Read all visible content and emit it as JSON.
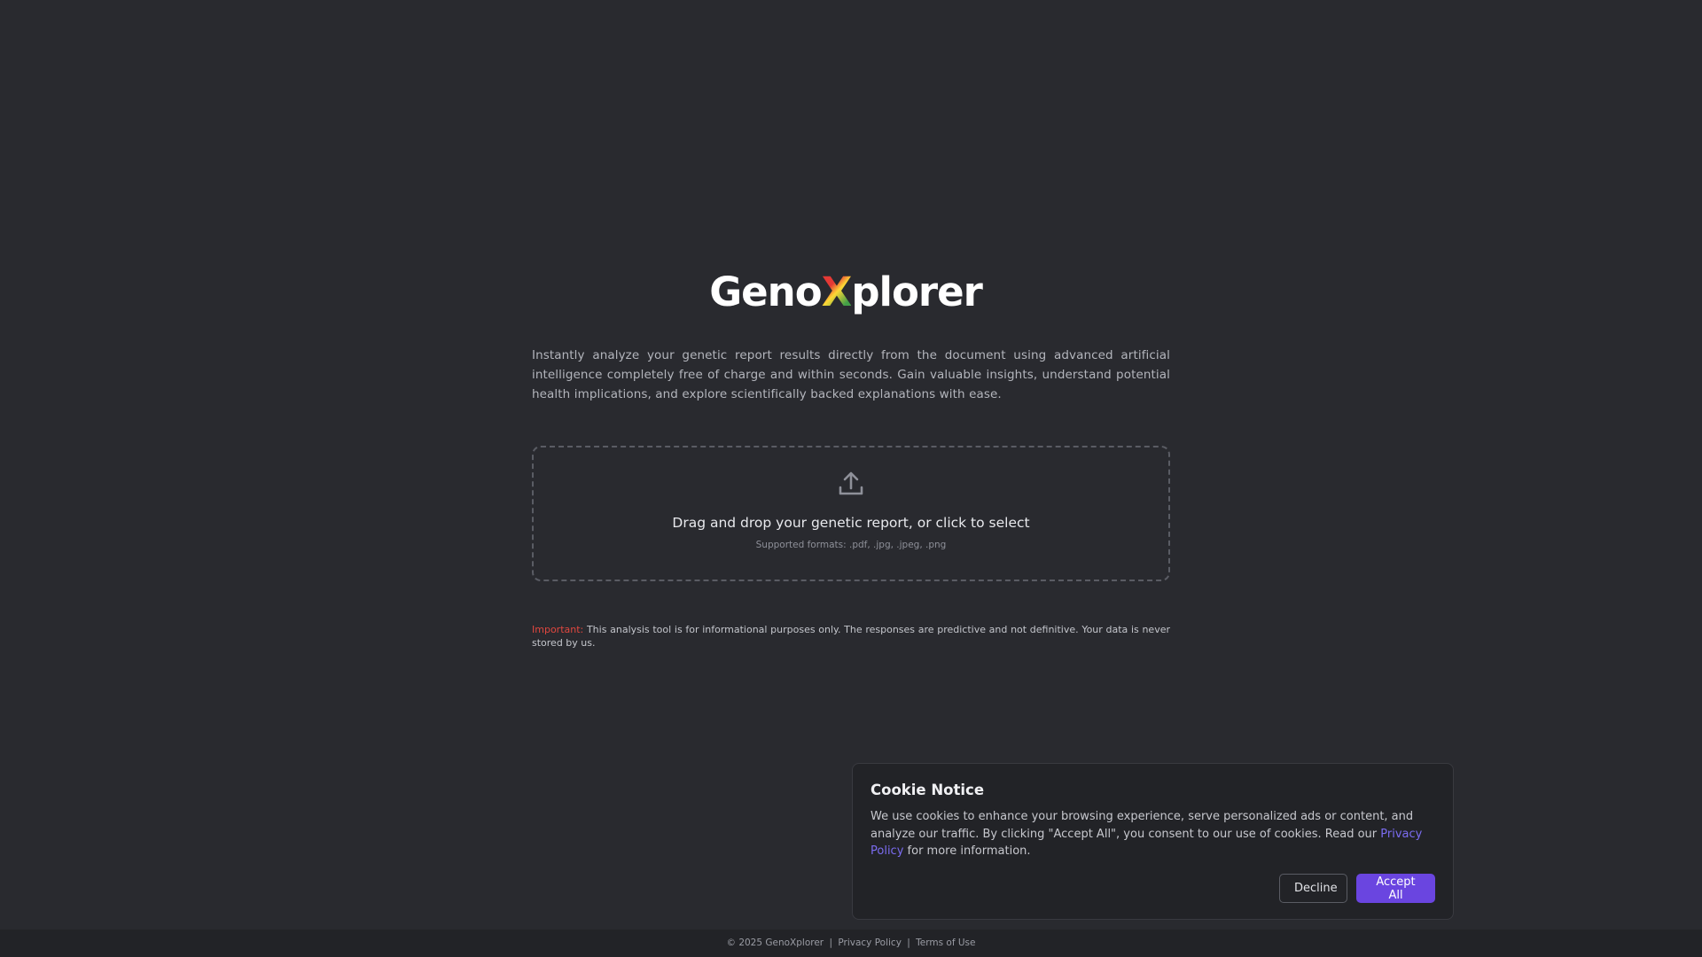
{
  "brand": {
    "logo_prefix": "Geno",
    "logo_x": "X",
    "logo_suffix": "plorer"
  },
  "hero": {
    "description": "Instantly analyze your genetic report results directly from the document using advanced artificial intelligence completely free of charge and within seconds. Gain valuable insights, understand potential health implications, and explore scientifically backed explanations with ease."
  },
  "dropzone": {
    "icon": "upload-icon",
    "title": "Drag and drop your genetic report, or click to select",
    "formats": "Supported formats: .pdf, .jpg, .jpeg, .png"
  },
  "notice": {
    "label": "Important:",
    "text": " This analysis tool is for informational purposes only. The responses are predictive and not definitive. Your data is never stored by us."
  },
  "cookie": {
    "title": "Cookie Notice",
    "text_before": "We use cookies to enhance your browsing experience, serve personalized ads or content, and analyze our traffic. By clicking \"Accept All\", you consent to our use of cookies. Read our ",
    "link": "Privacy Policy",
    "text_after": " for more information.",
    "decline_label": "Decline",
    "accept_label": "Accept All"
  },
  "footer": {
    "copyright": "© 2025 GenoXplorer",
    "sep": "|",
    "privacy": "Privacy Policy",
    "terms": "Terms of Use"
  },
  "colors": {
    "background": "#292a2f",
    "accent": "#6a45e0",
    "important": "#e0473f",
    "link": "#7b6cf0"
  }
}
